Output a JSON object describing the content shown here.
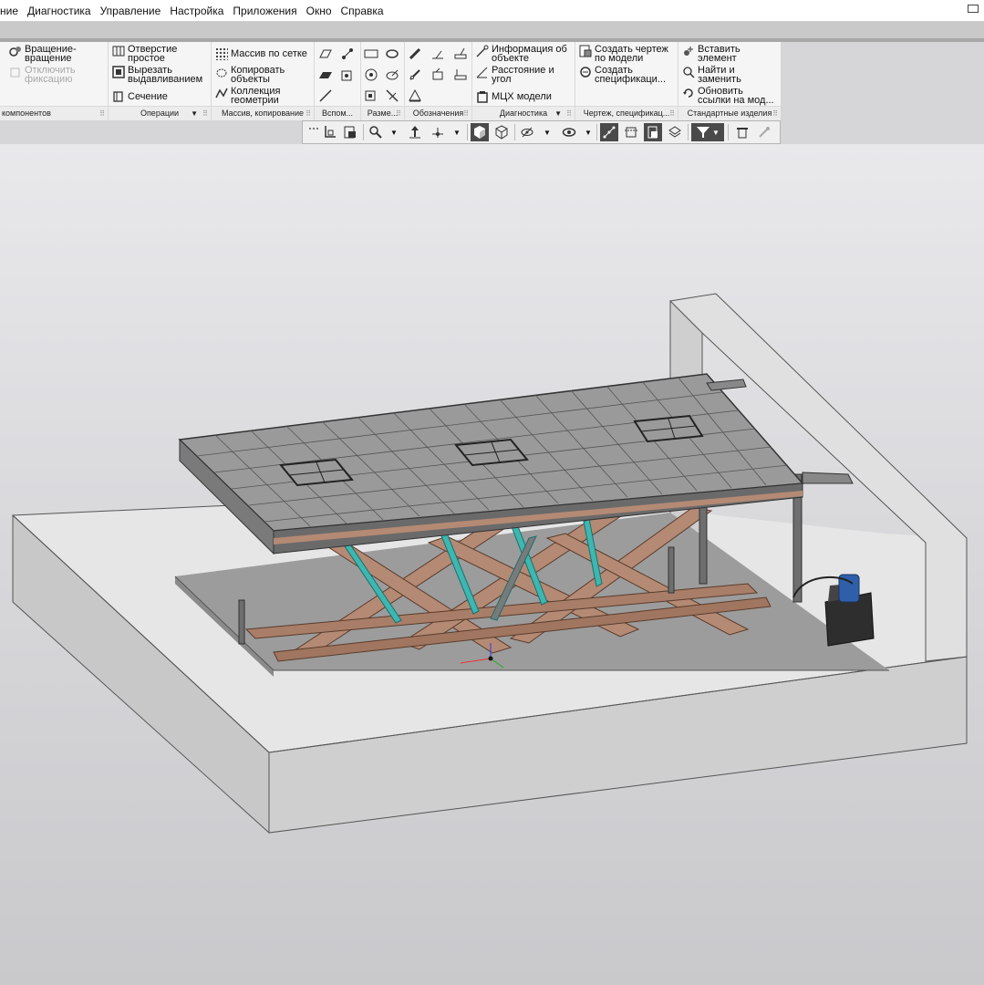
{
  "menu": {
    "items": [
      "ние",
      "Диагностика",
      "Управление",
      "Настройка",
      "Приложения",
      "Окно",
      "Справка"
    ]
  },
  "ribbon": {
    "components": {
      "rotate_label_1": "Вращение-",
      "rotate_label_2": "вращение",
      "unfix_label_1": "Отключить",
      "unfix_label_2": "фиксацию",
      "title": "компонентов"
    },
    "operations": {
      "hole_1": "Отверстие",
      "hole_2": "простое",
      "cut_1": "Вырезать",
      "cut_2": "выдавливанием",
      "section": "Сечение",
      "title": "Операции"
    },
    "pattern": {
      "grid": "Массив по сетке",
      "copy_1": "Копировать",
      "copy_2": "объекты",
      "collection_1": "Коллекция",
      "collection_2": "геометрии",
      "title": "Массив, копирование"
    },
    "aux": {
      "title": "Вспом..."
    },
    "dimensions": {
      "title": "Разме..."
    },
    "notations": {
      "title": "Обозначения"
    },
    "diagnostics": {
      "info_1": "Информация об",
      "info_2": "объекте",
      "distance_1": "Расстояние и",
      "distance_2": "угол",
      "mass": "МЦХ модели",
      "title": "Диагностика"
    },
    "drawing": {
      "create_drawing_1": "Создать чертеж",
      "create_drawing_2": "по модели",
      "create_spec_1": "Создать",
      "create_spec_2": "спецификаци...",
      "title": "Чертеж, спецификац..."
    },
    "standard": {
      "insert_1": "Вставить",
      "insert_2": "элемент",
      "find_1": "Найти и",
      "find_2": "заменить",
      "update_1": "Обновить",
      "update_2": "ссылки на мод...",
      "title": "Стандартные изделия"
    }
  },
  "colors": {
    "scissor": "#b48a74",
    "cylinder": "#3fb6b0",
    "deck": "#8a8a8a",
    "concrete": "#e4e4e4",
    "motor": "#2f5fa8"
  },
  "icons": [
    "rotate-icon",
    "unfix-icon",
    "hole-icon",
    "cut-extrude-icon",
    "section-icon",
    "grid-pattern-icon",
    "copy-objects-icon",
    "geometry-collection-icon",
    "info-icon",
    "distance-icon",
    "mass-properties-icon",
    "create-drawing-icon",
    "create-spec-icon",
    "insert-element-icon",
    "find-replace-icon",
    "update-links-icon",
    "filter-icon"
  ]
}
